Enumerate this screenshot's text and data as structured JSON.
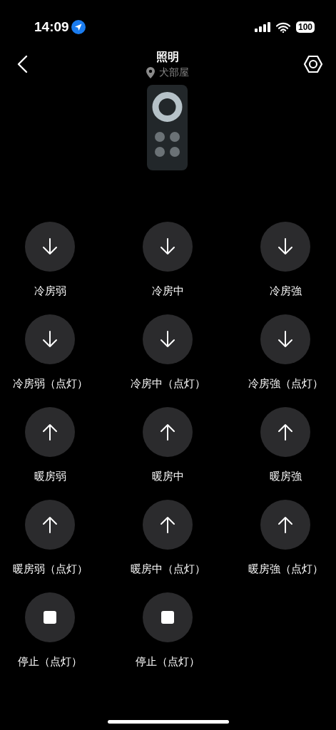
{
  "status_bar": {
    "time": "14:09",
    "battery": "100"
  },
  "header": {
    "title": "照明",
    "location": "犬部屋"
  },
  "buttons": [
    {
      "label": "冷房弱",
      "kind": "down"
    },
    {
      "label": "冷房中",
      "kind": "down"
    },
    {
      "label": "冷房強",
      "kind": "down"
    },
    {
      "label": "冷房弱（点灯）",
      "kind": "down"
    },
    {
      "label": "冷房中（点灯）",
      "kind": "down"
    },
    {
      "label": "冷房強（点灯）",
      "kind": "down"
    },
    {
      "label": "暖房弱",
      "kind": "up"
    },
    {
      "label": "暖房中",
      "kind": "up"
    },
    {
      "label": "暖房強",
      "kind": "up"
    },
    {
      "label": "暖房弱（点灯）",
      "kind": "up"
    },
    {
      "label": "暖房中（点灯）",
      "kind": "up"
    },
    {
      "label": "暖房強（点灯）",
      "kind": "up"
    },
    {
      "label": "停止（点灯）",
      "kind": "stop"
    },
    {
      "label": "停止（点灯）",
      "kind": "stop"
    }
  ]
}
